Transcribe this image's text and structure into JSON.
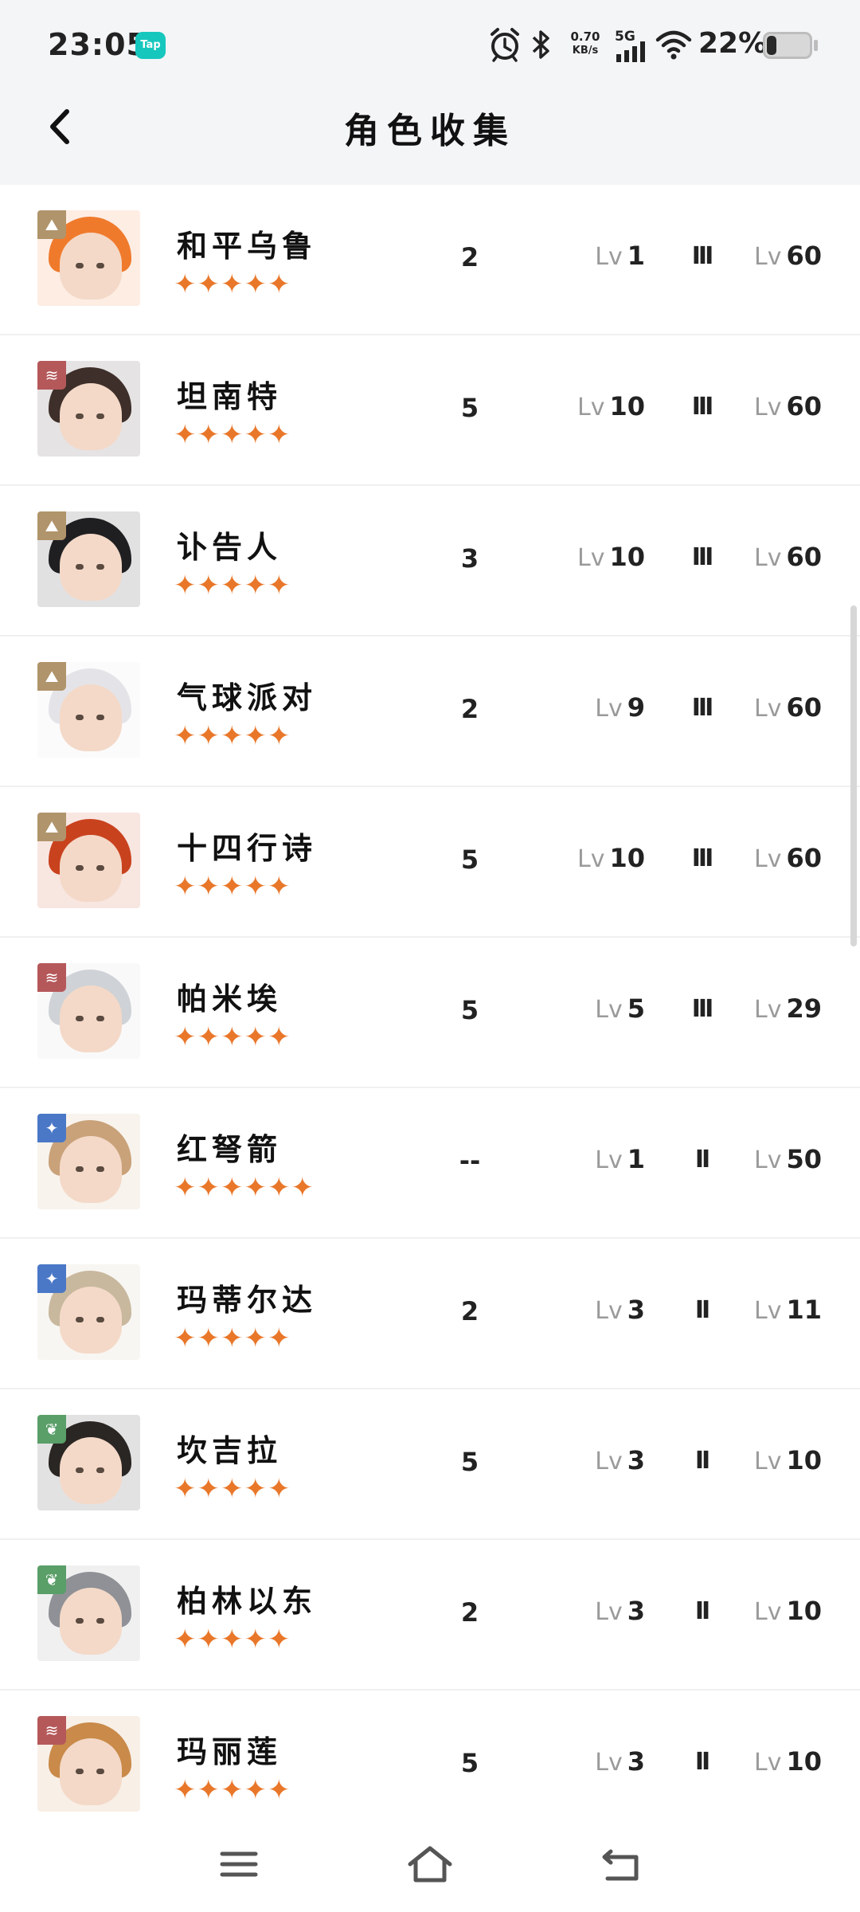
{
  "status_bar": {
    "time": "23:05",
    "app_badge": "Tap",
    "net_speed_value": "0.70",
    "net_speed_unit": "KB/s",
    "network_type": "5G",
    "battery_percent": "22%"
  },
  "header": {
    "title": "角色收集"
  },
  "rows": [
    {
      "name": "和平乌鲁",
      "stars": "✦✦✦✦✦",
      "rank": "2",
      "lv_prefix": "Lv",
      "level": "1",
      "tier": "III",
      "max_prefix": "Lv",
      "max_level": "60",
      "element": "mineral",
      "element_color": "#b0946b",
      "hair_color": "#f07a2c"
    },
    {
      "name": "坦南特",
      "stars": "✦✦✦✦✦",
      "rank": "5",
      "lv_prefix": "Lv",
      "level": "10",
      "tier": "III",
      "max_prefix": "Lv",
      "max_level": "60",
      "element": "beast",
      "element_color": "#b5585a",
      "hair_color": "#3e2f2a"
    },
    {
      "name": "讣告人",
      "stars": "✦✦✦✦✦",
      "rank": "3",
      "lv_prefix": "Lv",
      "level": "10",
      "tier": "III",
      "max_prefix": "Lv",
      "max_level": "60",
      "element": "mineral",
      "element_color": "#b0946b",
      "hair_color": "#1f1f22"
    },
    {
      "name": "气球派对",
      "stars": "✦✦✦✦✦",
      "rank": "2",
      "lv_prefix": "Lv",
      "level": "9",
      "tier": "III",
      "max_prefix": "Lv",
      "max_level": "60",
      "element": "mineral",
      "element_color": "#b0946b",
      "hair_color": "#e4e4e8"
    },
    {
      "name": "十四行诗",
      "stars": "✦✦✦✦✦",
      "rank": "5",
      "lv_prefix": "Lv",
      "level": "10",
      "tier": "III",
      "max_prefix": "Lv",
      "max_level": "60",
      "element": "mineral",
      "element_color": "#b0946b",
      "hair_color": "#c9421e"
    },
    {
      "name": "帕米埃",
      "stars": "✦✦✦✦✦",
      "rank": "5",
      "lv_prefix": "Lv",
      "level": "5",
      "tier": "III",
      "max_prefix": "Lv",
      "max_level": "29",
      "element": "beast",
      "element_color": "#b5585a",
      "hair_color": "#cfd2d6"
    },
    {
      "name": "红弩箭",
      "stars": "✦✦✦✦✦✦",
      "rank": "--",
      "lv_prefix": "Lv",
      "level": "1",
      "tier": "II",
      "max_prefix": "Lv",
      "max_level": "50",
      "element": "star",
      "element_color": "#4a78c7",
      "hair_color": "#c9a27a"
    },
    {
      "name": "玛蒂尔达",
      "stars": "✦✦✦✦✦",
      "rank": "2",
      "lv_prefix": "Lv",
      "level": "3",
      "tier": "II",
      "max_prefix": "Lv",
      "max_level": "11",
      "element": "star",
      "element_color": "#4a78c7",
      "hair_color": "#c8b89e"
    },
    {
      "name": "坎吉拉",
      "stars": "✦✦✦✦✦",
      "rank": "5",
      "lv_prefix": "Lv",
      "level": "3",
      "tier": "II",
      "max_prefix": "Lv",
      "max_level": "10",
      "element": "plant",
      "element_color": "#5a9e68",
      "hair_color": "#2a2623"
    },
    {
      "name": "柏林以东",
      "stars": "✦✦✦✦✦",
      "rank": "2",
      "lv_prefix": "Lv",
      "level": "3",
      "tier": "II",
      "max_prefix": "Lv",
      "max_level": "10",
      "element": "plant",
      "element_color": "#5a9e68",
      "hair_color": "#8f9196"
    },
    {
      "name": "玛丽莲",
      "stars": "✦✦✦✦✦",
      "rank": "5",
      "lv_prefix": "Lv",
      "level": "3",
      "tier": "II",
      "max_prefix": "Lv",
      "max_level": "10",
      "element": "beast",
      "element_color": "#b5585a",
      "hair_color": "#c98a4a"
    }
  ],
  "nav": {
    "menu_icon": "menu-icon",
    "home_icon": "home-icon",
    "back_icon": "back-icon"
  }
}
